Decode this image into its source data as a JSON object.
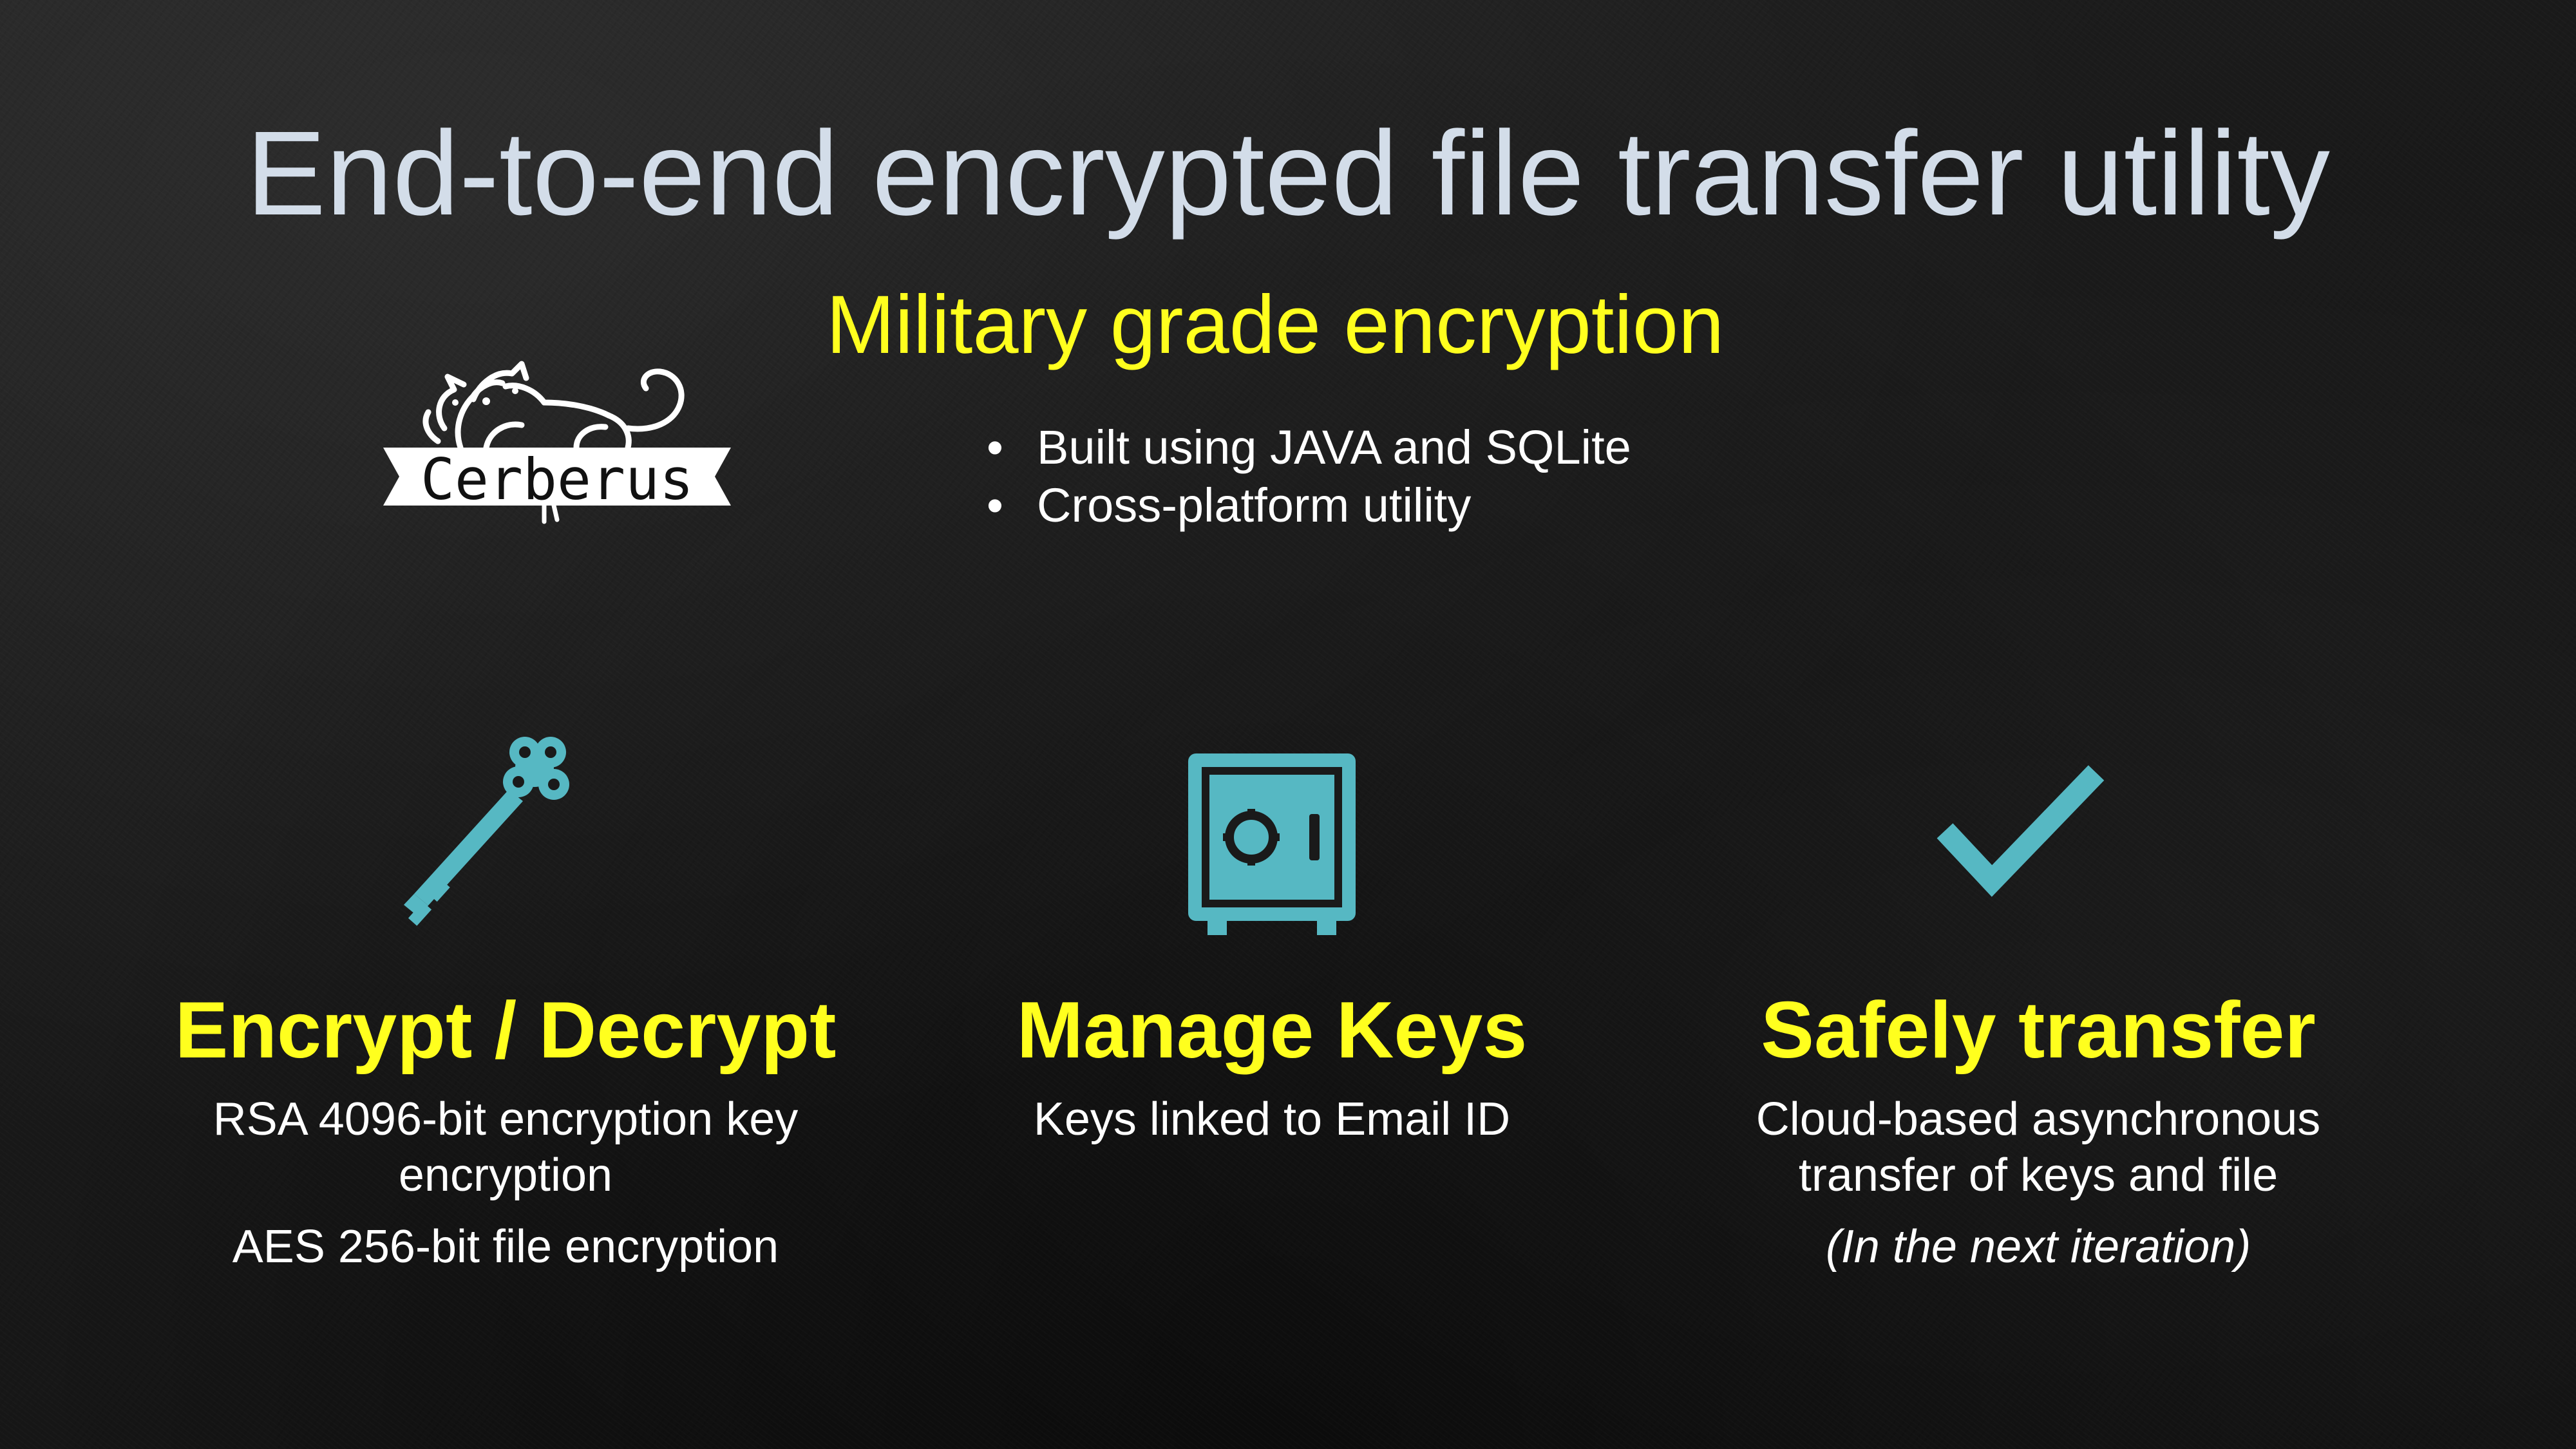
{
  "slide": {
    "title": "End-to-end encrypted file transfer utility",
    "subtitle": "Military grade encryption",
    "logo": {
      "text": "Cerberus",
      "icon": "cerberus-logo-icon"
    },
    "bullets": [
      "Built using JAVA and SQLite",
      "Cross-platform utility"
    ],
    "bullet_glyph": "•",
    "features": [
      {
        "icon": "key-icon",
        "heading": "Encrypt / Decrypt",
        "lines": [
          "RSA 4096-bit encryption key encryption",
          "AES 256-bit file encryption"
        ]
      },
      {
        "icon": "safe-icon",
        "heading": "Manage Keys",
        "lines": [
          "Keys linked to Email ID"
        ]
      },
      {
        "icon": "checkmark-icon",
        "heading": "Safely transfer",
        "lines": [
          "Cloud-based asynchronous transfer of keys and file",
          "(In the next iteration)"
        ]
      }
    ]
  },
  "colors": {
    "title": "#d3dde9",
    "accent_yellow": "#ffff1e",
    "icon_teal": "#56b8c3",
    "body_text": "#ffffff",
    "background": "#1a1a1a"
  }
}
